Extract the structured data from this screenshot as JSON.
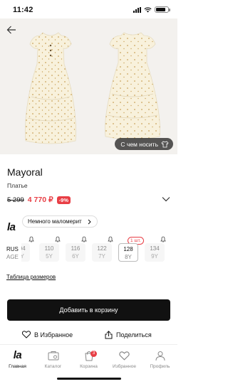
{
  "status_bar": {
    "time": "11:42"
  },
  "gallery": {
    "try_on_label": "С чем носить"
  },
  "product": {
    "brand": "Mayoral",
    "category": "Платье",
    "old_price": "5 299",
    "new_price": "4 770 ₽",
    "discount": "-9%"
  },
  "fit": {
    "logo": "la",
    "label": "Немного маломерит"
  },
  "sizes": {
    "row_label_rus": "RUS",
    "row_label_age": "AGE",
    "stock_badge": "1 шт.",
    "items": [
      {
        "rus": "104",
        "age": "4Y",
        "available": false
      },
      {
        "rus": "110",
        "age": "5Y",
        "available": false
      },
      {
        "rus": "116",
        "age": "6Y",
        "available": false
      },
      {
        "rus": "122",
        "age": "7Y",
        "available": false
      },
      {
        "rus": "128",
        "age": "8Y",
        "available": true
      },
      {
        "rus": "134",
        "age": "9Y",
        "available": false
      }
    ]
  },
  "size_table_link": "Таблица размеров",
  "actions": {
    "add_to_cart": "Добавить в корзину",
    "favorite": "В Избранное",
    "share": "Поделиться"
  },
  "tab_bar": {
    "logo": "la",
    "cart_count": "3",
    "tabs": [
      {
        "label": "Главная",
        "icon": "home-logo-icon",
        "active": true
      },
      {
        "label": "Каталог",
        "icon": "catalog-icon",
        "active": false
      },
      {
        "label": "Корзина",
        "icon": "cart-icon",
        "active": false
      },
      {
        "label": "Избранное",
        "icon": "heart-icon",
        "active": false
      },
      {
        "label": "Профиль",
        "icon": "profile-icon",
        "active": false
      }
    ]
  },
  "colors": {
    "accent": "#e83e45",
    "primary": "#111111",
    "gallery_bg": "#f3f1ee"
  }
}
